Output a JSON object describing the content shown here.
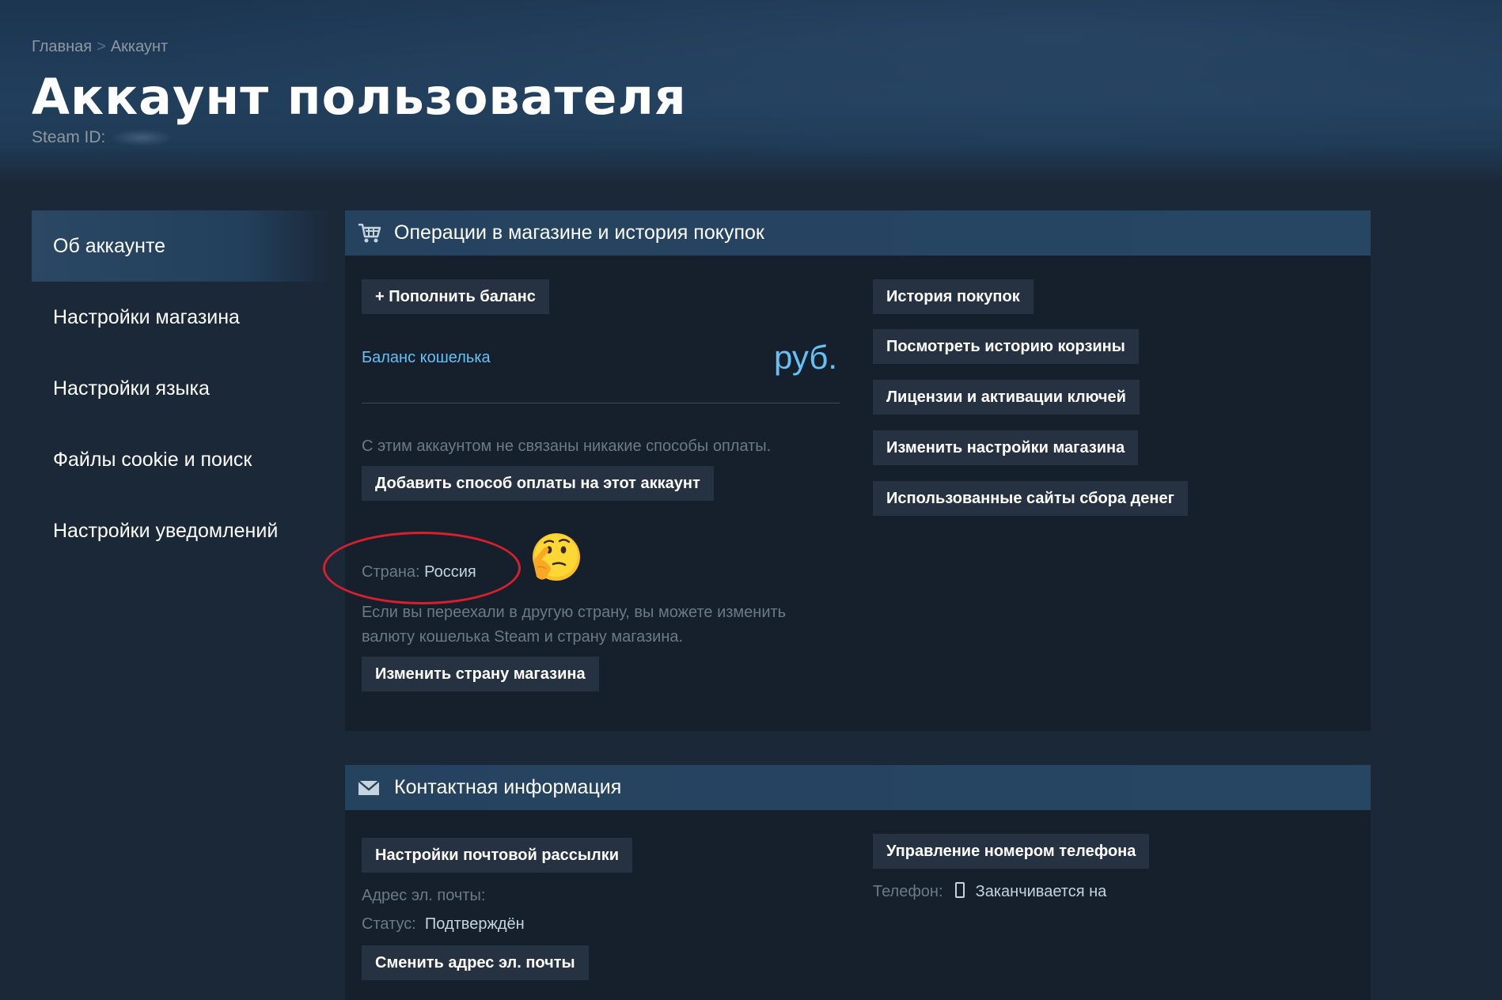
{
  "breadcrumb": {
    "home": "Главная",
    "separator": ">",
    "current": "Аккаунт"
  },
  "header": {
    "title": "Аккаунт пользователя",
    "steam_id_label": "Steam ID:"
  },
  "sidebar": {
    "items": [
      {
        "label": "Об аккаунте",
        "active": true
      },
      {
        "label": "Настройки магазина"
      },
      {
        "label": "Настройки языка"
      },
      {
        "label": "Файлы cookie и поиск"
      },
      {
        "label": "Настройки уведомлений"
      }
    ]
  },
  "store": {
    "title": "Операции в магазине и история покупок",
    "icon": "cart-icon",
    "add_funds": "+ Пополнить баланс",
    "wallet_label": "Баланс кошелька",
    "wallet_currency": "руб.",
    "no_payment": "С этим аккаунтом не связаны никакие способы оплаты.",
    "add_payment": "Добавить способ оплаты на этот аккаунт",
    "country_label": "Страна:",
    "country_value": "Россия",
    "country_note_1": "Если вы переехали в другую страну, вы можете изменить",
    "country_note_2": "валюту кошелька Steam и страну магазина.",
    "change_country": "Изменить страну магазина",
    "right_buttons": [
      "История покупок",
      "Посмотреть историю корзины",
      "Лицензии и активации ключей",
      "Изменить настройки магазина",
      "Использованные сайты сбора денег"
    ]
  },
  "contact": {
    "title": "Контактная информация",
    "icon": "mail-icon",
    "newsletter": "Настройки почтовой рассылки",
    "email_label": "Адрес эл. почты:",
    "status_label": "Статус:",
    "status_value": "Подтверждён",
    "change_email": "Сменить адрес эл. почты",
    "manage_phone": "Управление номером телефона",
    "phone_label": "Телефон:",
    "phone_value": "Заканчивается на"
  },
  "annotations": {
    "emoji": "thinking-face-emoji",
    "highlight_color": "#d6202b"
  },
  "colors": {
    "accent": "#66c0f4",
    "background": "#1b2838",
    "panel": "#16202d",
    "button": "#263241"
  }
}
